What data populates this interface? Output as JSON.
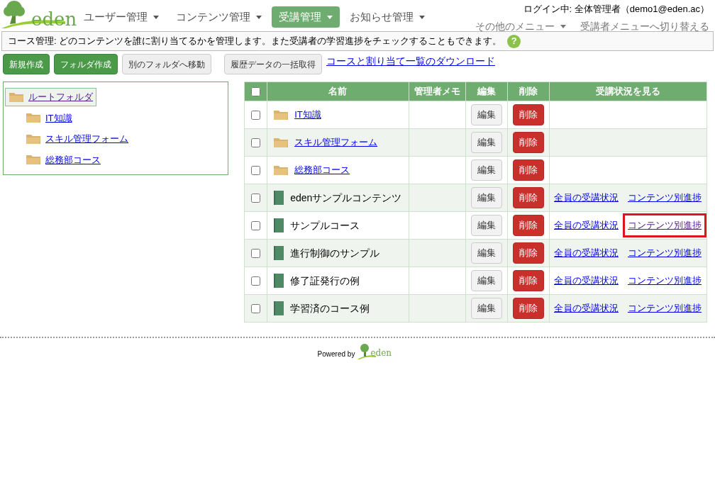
{
  "logo": {
    "text": "eden"
  },
  "nav": [
    {
      "label": "ユーザー管理",
      "selected": false
    },
    {
      "label": "コンテンツ管理",
      "selected": false
    },
    {
      "label": "受講管理",
      "selected": true
    },
    {
      "label": "お知らせ管理",
      "selected": false
    }
  ],
  "login": "ログイン中: 全体管理者（demo1@eden.ac）",
  "other_menu": "その他のメニュー",
  "switch_menu": "受講者メニューへ切り替える",
  "info": "コース管理: どのコンテンツを誰に割り当てるかを管理します。また受講者の学習進捗をチェックすることもできます。",
  "help_icon": "?",
  "toolbar": [
    {
      "label": "新規作成",
      "kind": "primary"
    },
    {
      "label": "フォルダ作成",
      "kind": "primary"
    },
    {
      "label": "別のフォルダへ移動",
      "kind": "default"
    },
    {
      "label": "履歴データの一括取得",
      "kind": "default"
    },
    {
      "label": "コースと割り当て一覧のダウンロード",
      "kind": "link"
    }
  ],
  "tree": [
    {
      "label": "ルートフォルダ",
      "selected": true,
      "children": [
        {
          "label": "IT知識",
          "selected": false
        },
        {
          "label": "スキル管理フォーム",
          "selected": false
        },
        {
          "label": "総務部コース",
          "selected": false
        }
      ]
    }
  ],
  "table": {
    "columns": [
      "名前",
      "管理者メモ",
      "編集",
      "削除",
      "受講状況を見る"
    ],
    "select_all": {
      "checked": false
    },
    "rows": [
      {
        "kind": "folder",
        "name": "IT知識",
        "checked": false,
        "edit": "編集",
        "delete": "削除"
      },
      {
        "kind": "folder",
        "name": "スキル管理フォーム",
        "checked": false,
        "edit": "編集",
        "delete": "削除"
      },
      {
        "kind": "folder",
        "name": "総務部コース",
        "checked": false,
        "edit": "編集",
        "delete": "削除"
      },
      {
        "kind": "course",
        "name": "edenサンプルコンテンツ",
        "checked": false,
        "edit": "編集",
        "delete": "削除",
        "status_link": "全員の受講状況",
        "progress_link": "コンテンツ別進捗",
        "highlighted": false
      },
      {
        "kind": "course",
        "name": "サンプルコース",
        "checked": false,
        "edit": "編集",
        "delete": "削除",
        "status_link": "全員の受講状況",
        "progress_link": "コンテンツ別進捗",
        "highlighted": true
      },
      {
        "kind": "course",
        "name": "進行制御のサンプル",
        "checked": false,
        "edit": "編集",
        "delete": "削除",
        "status_link": "全員の受講状況",
        "progress_link": "コンテンツ別進捗",
        "highlighted": false
      },
      {
        "kind": "course",
        "name": "修了証発行の例",
        "checked": false,
        "edit": "編集",
        "delete": "削除",
        "status_link": "全員の受講状況",
        "progress_link": "コンテンツ別進捗",
        "highlighted": false
      },
      {
        "kind": "course",
        "name": "学習済のコース例",
        "checked": false,
        "edit": "編集",
        "delete": "削除",
        "status_link": "全員の受講状況",
        "progress_link": "コンテンツ別進捗",
        "highlighted": false
      }
    ]
  },
  "footer": {
    "powered_by": "Powered by",
    "logo_text": "eden"
  }
}
